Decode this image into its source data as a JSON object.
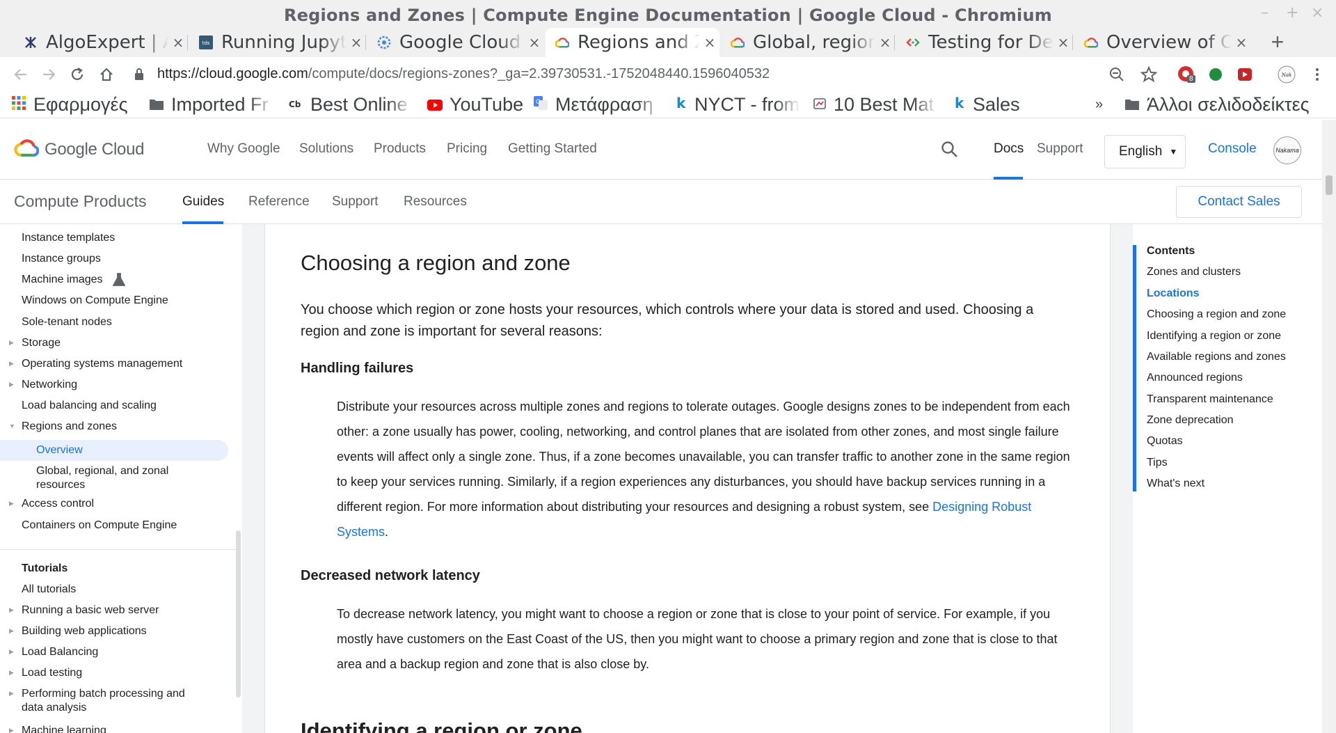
{
  "window": {
    "title": "Regions and Zones  |  Compute Engine Documentation  |  Google Cloud - Chromium",
    "controls": {
      "minimize": "–",
      "maximize": "+",
      "close": "×"
    }
  },
  "tabs": [
    {
      "title": "AlgoExpert | A",
      "icon": "algoexpert-icon",
      "close": "×"
    },
    {
      "title": "Running Jupyt",
      "icon": "tds-icon",
      "close": "×"
    },
    {
      "title": "Google Cloud",
      "icon": "google-cloud-chip-icon",
      "close": "×"
    },
    {
      "title": "Regions and Z",
      "icon": "google-cloud-icon",
      "close": "×",
      "active": true
    },
    {
      "title": "Global, region",
      "icon": "google-cloud-icon",
      "close": "×"
    },
    {
      "title": "Testing for De",
      "icon": "code-icon",
      "close": "×"
    },
    {
      "title": "Overview of C",
      "icon": "google-cloud-icon",
      "close": "×"
    }
  ],
  "new_tab": "+",
  "toolbar": {
    "url_host": "https://cloud.google.com",
    "url_rest": "/compute/docs/regions-zones?_ga=2.39730531.-1752048440.1596040532",
    "extension_badge": "8"
  },
  "bookmarks": {
    "apps_label": "Εφαρμογές",
    "items": [
      {
        "label": "Imported Fr",
        "icon": "folder-icon"
      },
      {
        "label": "Best Online",
        "icon": "cb-icon"
      },
      {
        "label": "YouTube",
        "icon": "youtube-icon"
      },
      {
        "label": "Μετάφραση",
        "icon": "translate-icon"
      },
      {
        "label": "NYCT - from",
        "icon": "k-icon"
      },
      {
        "label": "10 Best Mat",
        "icon": "bookmark-icon"
      },
      {
        "label": "Sales",
        "icon": "k-icon"
      }
    ],
    "overflow": "»",
    "other_label": "Άλλοι σελιδοδείκτες"
  },
  "gc_header": {
    "logo_text": "Google Cloud",
    "nav": [
      "Why Google",
      "Solutions",
      "Products",
      "Pricing",
      "Getting Started"
    ],
    "docs": "Docs",
    "support": "Support",
    "language": "English",
    "console": "Console",
    "avatar_text": "Nakama"
  },
  "sub_header": {
    "product": "Compute Products",
    "tabs": [
      "Guides",
      "Reference",
      "Support",
      "Resources"
    ],
    "contact_sales": "Contact Sales"
  },
  "leftnav": {
    "items": [
      {
        "label": "Instance templates"
      },
      {
        "label": "Instance groups"
      },
      {
        "label": "Machine images"
      },
      {
        "label": "Windows on Compute Engine"
      },
      {
        "label": "Sole-tenant nodes"
      },
      {
        "label": "Storage"
      },
      {
        "label": "Operating systems management"
      },
      {
        "label": "Networking"
      },
      {
        "label": "Load balancing and scaling"
      },
      {
        "label": "Regions and zones"
      },
      {
        "label": "Overview"
      },
      {
        "label": "Global, regional, and zonal resources"
      },
      {
        "label": "Access control"
      },
      {
        "label": "Containers on Compute Engine"
      },
      {
        "label": "Tutorials"
      },
      {
        "label": "All tutorials"
      },
      {
        "label": "Running a basic web server"
      },
      {
        "label": "Building web applications"
      },
      {
        "label": "Load Balancing"
      },
      {
        "label": "Load testing"
      },
      {
        "label": "Performing batch processing and data analysis"
      },
      {
        "label": "Machine learning"
      }
    ]
  },
  "article": {
    "heading": "Choosing a region and zone",
    "intro": "You choose which region or zone hosts your resources, which controls where your data is stored and used. Choosing a region and zone is important for several reasons:",
    "sections": [
      {
        "heading": "Handling failures",
        "text": "Distribute your resources across multiple zones and regions to tolerate outages. Google designs zones to be independent from each other: a zone usually has power, cooling, networking, and control planes that are isolated from other zones, and most single failure events will affect only a single zone. Thus, if a zone becomes unavailable, you can transfer traffic to another zone in the same region to keep your services running. Similarly, if a region experiences any disturbances, you should have backup services running in a different region. For more information about distributing your resources and designing a robust system, see ",
        "link": "Designing Robust Systems",
        "after": "."
      },
      {
        "heading": "Decreased network latency",
        "text": "To decrease network latency, you might want to choose a region or zone that is close to your point of service. For example, if you mostly have customers on the East Coast of the US, then you might want to choose a primary region and zone that is close to that area and a backup region and zone that is also close by."
      }
    ],
    "next_heading": "Identifying a region or zone"
  },
  "toc": {
    "title": "Contents",
    "items": [
      "Zones and clusters",
      "Locations",
      "Choosing a region and zone",
      "Identifying a region or zone",
      "Available regions and zones",
      "Announced regions",
      "Transparent maintenance",
      "Zone deprecation",
      "Quotas",
      "Tips",
      "What's next"
    ],
    "active_index": 1
  },
  "colors": {
    "accent": "#1a73e8",
    "selected_bg": "#e8f0fe",
    "text": "#202124",
    "muted": "#5f6368"
  }
}
